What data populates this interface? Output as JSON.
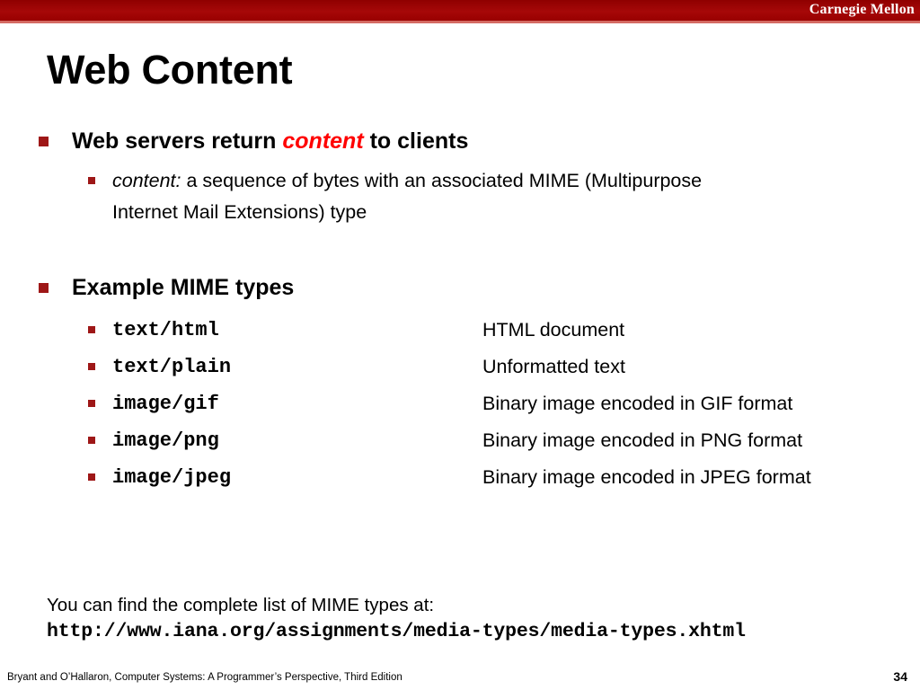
{
  "banner": {
    "brand": "Carnegie Mellon",
    "bg_color": "#990000",
    "underline_color": "#d46a63"
  },
  "title": "Web Content",
  "accent_color": "#9e1717",
  "highlight_color": "#ff0000",
  "sections": [
    {
      "heading_pre": "Web servers return ",
      "heading_highlight": "content",
      "heading_post": " to clients",
      "sub": {
        "lead": "content:",
        "rest_line1": " a sequence of bytes with an associated MIME (Multipurpose",
        "line2": "Internet Mail Extensions) type"
      }
    },
    {
      "heading": "Example MIME types",
      "rows": [
        {
          "type": "text/html",
          "desc": "HTML document"
        },
        {
          "type": "text/plain",
          "desc": "Unformatted text"
        },
        {
          "type": "image/gif",
          "desc": "Binary image encoded in GIF format"
        },
        {
          "type": "image/png",
          "desc": "Binary image encoded in PNG format"
        },
        {
          "type": "image/jpeg",
          "desc": "Binary image encoded in JPEG format"
        }
      ]
    }
  ],
  "note": {
    "line": "You can find the complete list of MIME types at:",
    "url": "http://www.iana.org/assignments/media-types/media-types.xhtml"
  },
  "footer": {
    "citation": "Bryant and O’Hallaron, Computer Systems: A Programmer’s Perspective, Third Edition",
    "page": "34"
  }
}
